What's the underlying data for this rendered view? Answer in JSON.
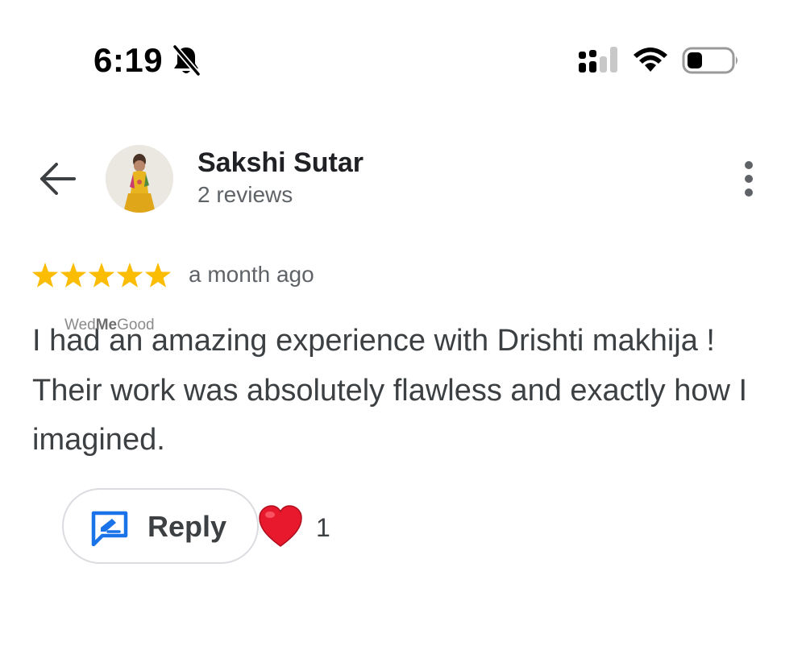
{
  "status_bar": {
    "time": "6:19",
    "icons": [
      "bell-slash-icon",
      "cellular-signal-icon",
      "wifi-icon",
      "battery-icon"
    ]
  },
  "header": {
    "back_icon": "arrow-left-icon",
    "avatar": "user-avatar-photo",
    "user_name": "Sakshi Sutar",
    "review_count": "2 reviews",
    "menu_icon": "more-vertical-icon"
  },
  "review": {
    "rating": 5,
    "rating_max": 5,
    "time": "a month ago",
    "text": "I had an amazing experience with Drishti makhija ! Their work was absolutely flawless and exactly how I imagined.",
    "watermark_pre": "Wed",
    "watermark_bold": "Me",
    "watermark_post": "Good"
  },
  "actions": {
    "reply_label": "Reply",
    "reply_icon": "reply-edit-icon",
    "reaction_icon": "red-heart-icon",
    "reaction_count": "1"
  },
  "colors": {
    "star": "#fbbc04",
    "reply_icon": "#1a73e8",
    "heart": "#e8192c",
    "secondary_text": "#5f6368",
    "body_text": "#3c4043"
  }
}
